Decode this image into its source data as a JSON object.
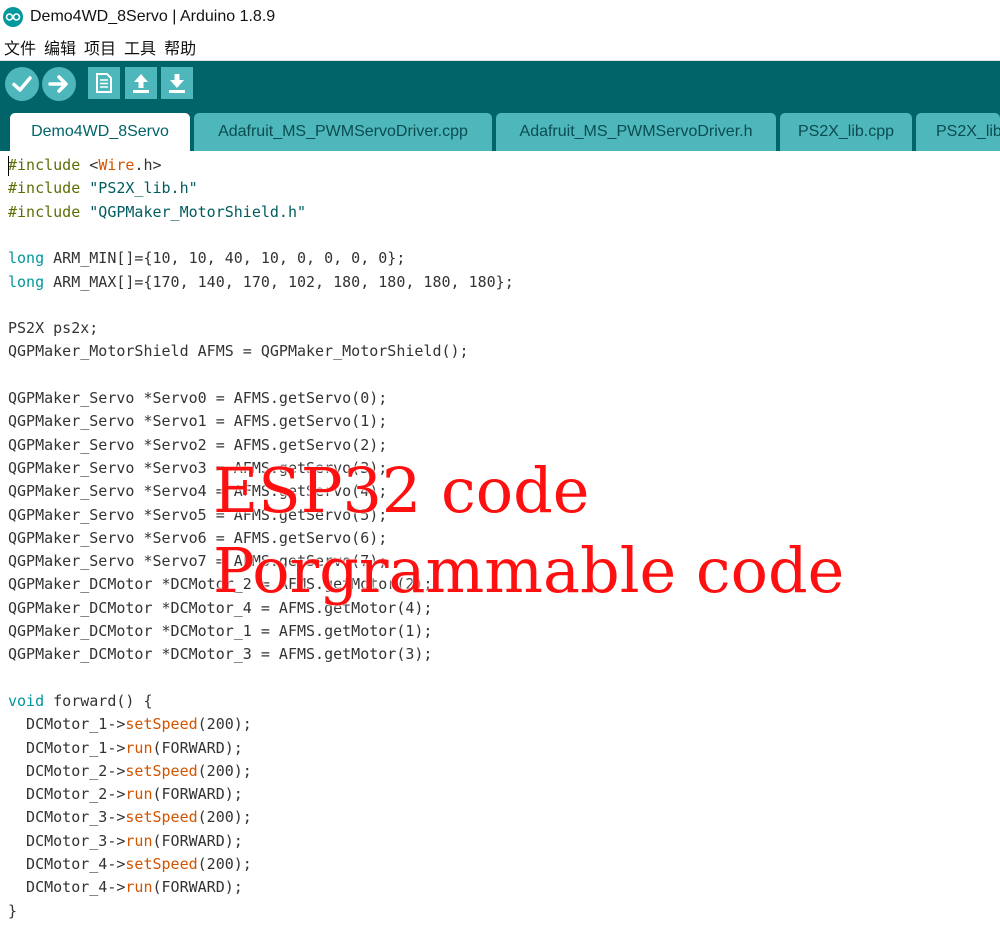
{
  "window": {
    "title": "Demo4WD_8Servo | Arduino 1.8.9"
  },
  "menu": {
    "items": [
      "文件",
      "编辑",
      "项目",
      "工具",
      "帮助"
    ]
  },
  "tabs": [
    {
      "label": "Demo4WD_8Servo",
      "active": true
    },
    {
      "label": "Adafruit_MS_PWMServoDriver.cpp",
      "active": false
    },
    {
      "label": "Adafruit_MS_PWMServoDriver.h",
      "active": false
    },
    {
      "label": "PS2X_lib.cpp",
      "active": false
    },
    {
      "label": "PS2X_lib",
      "active": false
    }
  ],
  "colors": {
    "toolbar_bg": "#006468",
    "button_bg": "#4db7bb",
    "keyword": "#5e6d03",
    "type": "#00979c",
    "string": "#005c5f",
    "function": "#d35400",
    "overlay_text": "#ff1010"
  },
  "toolbar_icons": [
    "verify-icon",
    "upload-icon",
    "new-icon",
    "open-icon",
    "save-icon"
  ],
  "code": [
    [
      {
        "t": "#include",
        "c": "kw"
      },
      {
        "t": " <"
      },
      {
        "t": "Wire",
        "c": "fn"
      },
      {
        "t": ".h>"
      }
    ],
    [
      {
        "t": "#include",
        "c": "kw"
      },
      {
        "t": " "
      },
      {
        "t": "\"PS2X_lib.h\"",
        "c": "str"
      }
    ],
    [
      {
        "t": "#include",
        "c": "kw"
      },
      {
        "t": " "
      },
      {
        "t": "\"QGPMaker_MotorShield.h\"",
        "c": "str"
      }
    ],
    [],
    [
      {
        "t": "long",
        "c": "type"
      },
      {
        "t": " ARM_MIN[]={10, 10, 40, 10, 0, 0, 0, 0};"
      }
    ],
    [
      {
        "t": "long",
        "c": "type"
      },
      {
        "t": " ARM_MAX[]={170, 140, 170, 102, 180, 180, 180, 180};"
      }
    ],
    [],
    [
      {
        "t": "PS2X ps2x;"
      }
    ],
    [
      {
        "t": "QGPMaker_MotorShield AFMS = QGPMaker_MotorShield();"
      }
    ],
    [],
    [
      {
        "t": "QGPMaker_Servo *Servo0 = AFMS.getServo(0);"
      }
    ],
    [
      {
        "t": "QGPMaker_Servo *Servo1 = AFMS.getServo(1);"
      }
    ],
    [
      {
        "t": "QGPMaker_Servo *Servo2 = AFMS.getServo(2);"
      }
    ],
    [
      {
        "t": "QGPMaker_Servo *Servo3 = AFMS.getServo(3);"
      }
    ],
    [
      {
        "t": "QGPMaker_Servo *Servo4 = AFMS.getServo(4);"
      }
    ],
    [
      {
        "t": "QGPMaker_Servo *Servo5 = AFMS.getServo(5);"
      }
    ],
    [
      {
        "t": "QGPMaker_Servo *Servo6 = AFMS.getServo(6);"
      }
    ],
    [
      {
        "t": "QGPMaker_Servo *Servo7 = AFMS.getServo(7);"
      }
    ],
    [
      {
        "t": "QGPMaker_DCMotor *DCMotor_2 = AFMS.getMotor(2);"
      }
    ],
    [
      {
        "t": "QGPMaker_DCMotor *DCMotor_4 = AFMS.getMotor(4);"
      }
    ],
    [
      {
        "t": "QGPMaker_DCMotor *DCMotor_1 = AFMS.getMotor(1);"
      }
    ],
    [
      {
        "t": "QGPMaker_DCMotor *DCMotor_3 = AFMS.getMotor(3);"
      }
    ],
    [],
    [
      {
        "t": "void",
        "c": "type"
      },
      {
        "t": " forward() {"
      }
    ],
    [
      {
        "t": "  DCMotor_1->"
      },
      {
        "t": "setSpeed",
        "c": "fn"
      },
      {
        "t": "(200);"
      }
    ],
    [
      {
        "t": "  DCMotor_1->"
      },
      {
        "t": "run",
        "c": "fn"
      },
      {
        "t": "(FORWARD);"
      }
    ],
    [
      {
        "t": "  DCMotor_2->"
      },
      {
        "t": "setSpeed",
        "c": "fn"
      },
      {
        "t": "(200);"
      }
    ],
    [
      {
        "t": "  DCMotor_2->"
      },
      {
        "t": "run",
        "c": "fn"
      },
      {
        "t": "(FORWARD);"
      }
    ],
    [
      {
        "t": "  DCMotor_3->"
      },
      {
        "t": "setSpeed",
        "c": "fn"
      },
      {
        "t": "(200);"
      }
    ],
    [
      {
        "t": "  DCMotor_3->"
      },
      {
        "t": "run",
        "c": "fn"
      },
      {
        "t": "(FORWARD);"
      }
    ],
    [
      {
        "t": "  DCMotor_4->"
      },
      {
        "t": "setSpeed",
        "c": "fn"
      },
      {
        "t": "(200);"
      }
    ],
    [
      {
        "t": "  DCMotor_4->"
      },
      {
        "t": "run",
        "c": "fn"
      },
      {
        "t": "(FORWARD);"
      }
    ],
    [
      {
        "t": "}"
      }
    ]
  ],
  "overlay": {
    "line1": "ESP32 code",
    "line2": "Porgrammable code"
  }
}
